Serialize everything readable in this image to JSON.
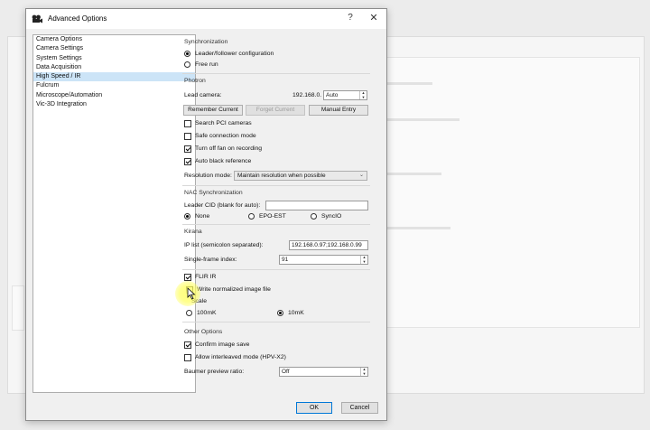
{
  "window": {
    "title": "Advanced Options",
    "help": "?",
    "close": "✕"
  },
  "nav": {
    "items": [
      {
        "label": "Camera Options",
        "selected": false
      },
      {
        "label": "Camera Settings",
        "selected": false
      },
      {
        "label": "System Settings",
        "selected": false
      },
      {
        "label": "Data Acquisition",
        "selected": false
      },
      {
        "label": "High Speed / IR",
        "selected": true
      },
      {
        "label": "Fulcrum",
        "selected": false
      },
      {
        "label": "Microscope/Automation",
        "selected": false
      },
      {
        "label": "Vic-3D Integration",
        "selected": false
      }
    ]
  },
  "sync": {
    "title": "Synchronization",
    "leader": "Leader/follower configuration",
    "free": "Free run"
  },
  "photron": {
    "title": "Photron",
    "lead_label": "Lead camera:",
    "ip_prefix": "192.168.0.",
    "lead_value": "Auto",
    "remember": "Remember Current",
    "forget": "Forget Current",
    "manual": "Manual Entry",
    "search_pci": "Search PCI cameras",
    "safe_conn": "Safe connection mode",
    "fan_off": "Turn off fan on recording",
    "auto_black": "Auto black reference",
    "res_label": "Resolution mode:",
    "res_value": "Maintain resolution when possible"
  },
  "nac": {
    "title": "NAC Synchronization",
    "cid_label": "Leader CID (blank for auto):",
    "cid_value": "",
    "none": "None",
    "epo": "EPO-EST",
    "syncio": "SyncIO"
  },
  "kirana": {
    "title": "Kirana",
    "ip_label": "IP list (semicolon separated):",
    "ip_value": "192.168.0.97;192.168.0.99",
    "frame_label": "Single-frame index:",
    "frame_value": "91"
  },
  "flir": {
    "title": "FLIR IR",
    "write_norm": "Write normalized image file",
    "scale": "Scale",
    "s100": "100mK",
    "s10": "10mK"
  },
  "other": {
    "title": "Other Options",
    "confirm": "Confirm image save",
    "interleaved": "Allow interleaved mode (HPV-X2)",
    "baumer_label": "Baumer preview ratio:",
    "baumer_value": "Off"
  },
  "footer": {
    "ok": "OK",
    "cancel": "Cancel"
  }
}
